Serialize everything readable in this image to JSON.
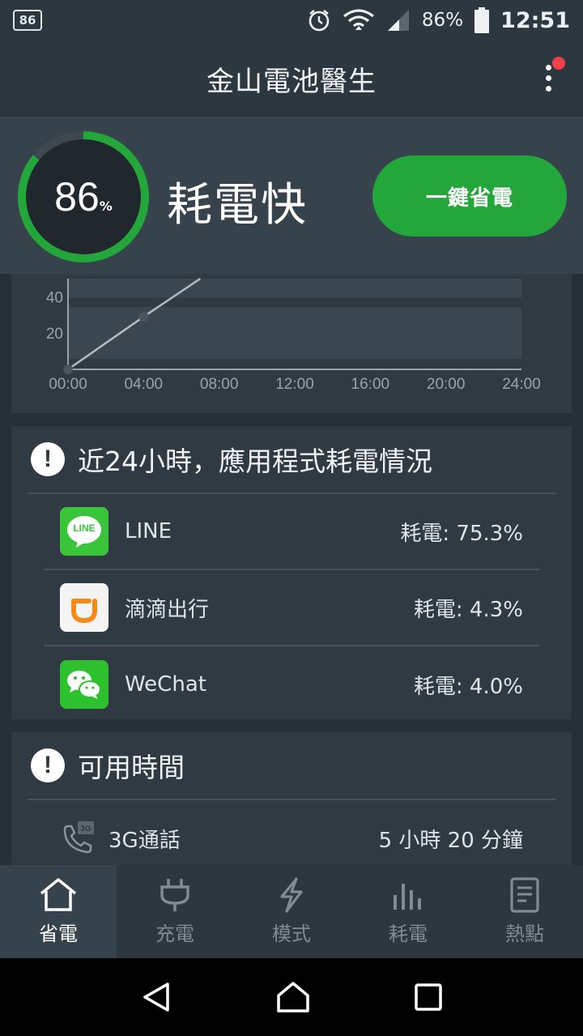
{
  "status_bar": {
    "notification_badge": "86",
    "battery_percent": "86%",
    "clock": "12:51",
    "icons": [
      "alarm-icon",
      "wifi-icon",
      "signal-icon",
      "battery-icon"
    ]
  },
  "app_bar": {
    "title": "金山電池醫生",
    "menu_icon": "overflow-menu-icon",
    "badge_color": "#f0404a"
  },
  "header": {
    "battery_level": "86",
    "battery_unit": "%",
    "battery_fraction": 0.86,
    "status": "耗電快",
    "save_button": "一鍵省電",
    "accent_color": "#23a73a"
  },
  "chart_data": {
    "type": "line",
    "x_ticks": [
      "00:00",
      "04:00",
      "08:00",
      "12:00",
      "16:00",
      "20:00",
      "24:00"
    ],
    "y_ticks": [
      "20",
      "40"
    ],
    "x_unit_hours": [
      0,
      4,
      8,
      12,
      16,
      20,
      24
    ],
    "series": [
      {
        "x": [
          0,
          4,
          7
        ],
        "y": [
          0,
          29,
          50
        ]
      }
    ],
    "ylim": [
      0,
      50
    ],
    "grid": true
  },
  "usage": {
    "title": "近24小時，應用程式耗電情況",
    "apps": [
      {
        "name": "LINE",
        "usage": "耗電: 75.3%",
        "icon": "line-app-icon",
        "icon_text": "LINE",
        "color": "#3ac43a"
      },
      {
        "name": "滴滴出行",
        "usage": "耗電:  4.3%",
        "icon": "didi-app-icon",
        "color": "#f28a1c"
      },
      {
        "name": "WeChat",
        "usage": "耗電:  4.0%",
        "icon": "wechat-app-icon",
        "color": "#2dc12d"
      }
    ]
  },
  "available_time": {
    "title": "可用時間",
    "rows": [
      {
        "label": "3G通話",
        "value": "5 小時 20 分鐘",
        "icon": "phone-3g-icon",
        "icon_text": "3G"
      }
    ]
  },
  "bottom_nav": [
    {
      "label": "省電",
      "icon": "home-icon",
      "active": true
    },
    {
      "label": "充電",
      "icon": "plug-icon",
      "active": false
    },
    {
      "label": "模式",
      "icon": "lightning-icon",
      "active": false
    },
    {
      "label": "耗電",
      "icon": "bar-chart-icon",
      "active": false
    },
    {
      "label": "熱點",
      "icon": "document-icon",
      "active": false
    }
  ],
  "system_nav": [
    "back-icon",
    "home-nav-icon",
    "recents-icon"
  ]
}
